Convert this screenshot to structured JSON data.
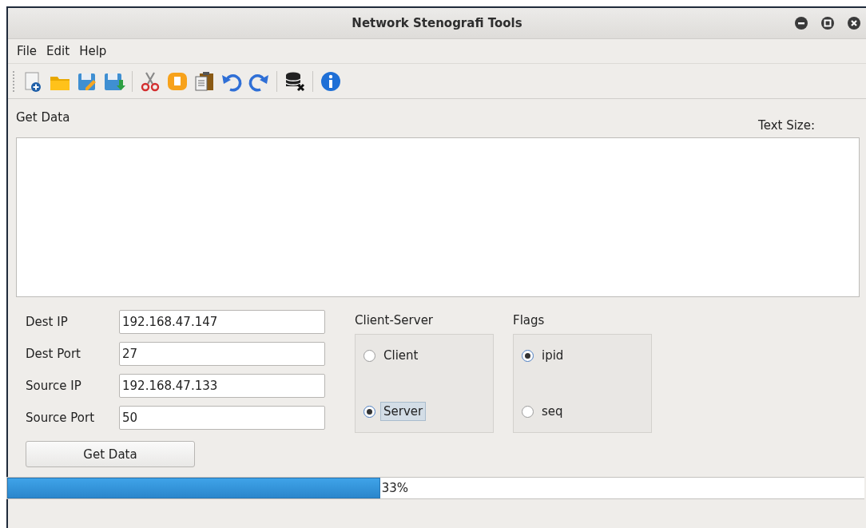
{
  "window": {
    "title": "Network Stenografi Tools"
  },
  "menu": [
    "File",
    "Edit",
    "Help"
  ],
  "toolbar": [
    {
      "kind": "new"
    },
    {
      "kind": "open"
    },
    {
      "kind": "edit"
    },
    {
      "kind": "save"
    },
    {
      "kind": "sep"
    },
    {
      "kind": "cut"
    },
    {
      "kind": "copy"
    },
    {
      "kind": "paste"
    },
    {
      "kind": "undo"
    },
    {
      "kind": "redo"
    },
    {
      "kind": "sep"
    },
    {
      "kind": "db"
    },
    {
      "kind": "sep"
    },
    {
      "kind": "info"
    }
  ],
  "output": {
    "label": "Get Data",
    "text_size_label": "Text Size:"
  },
  "fields": [
    {
      "label": "Dest IP",
      "value": "192.168.47.147"
    },
    {
      "label": "Dest Port",
      "value": "27"
    },
    {
      "label": "Source IP",
      "value": "192.168.47.133"
    },
    {
      "label": "Source Port",
      "value": "50"
    }
  ],
  "get_data_button": "Get Data",
  "client_server": {
    "title": "Client-Server",
    "options": [
      {
        "label": "Client",
        "selected": false
      },
      {
        "label": "Server",
        "selected": true
      }
    ]
  },
  "flags": {
    "title": "Flags",
    "options": [
      {
        "label": "ipid",
        "selected": true
      },
      {
        "label": "seq",
        "selected": false
      }
    ]
  },
  "progress": {
    "level": 0.435,
    "reading": "33%"
  }
}
